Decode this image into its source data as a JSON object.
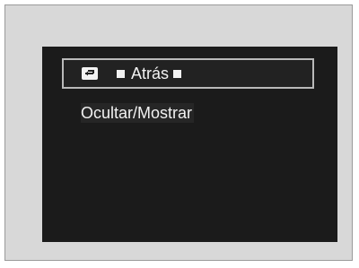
{
  "menu": {
    "back": {
      "icon": "return-arrow-icon",
      "label": "Atrás"
    },
    "items": [
      {
        "label": "Ocultar/Mostrar"
      }
    ]
  },
  "colors": {
    "screen_background": "#1b1b1b",
    "text": "#f2f2f2",
    "selection_border": "#b9b9b9",
    "outer_background": "#d8d8d8"
  }
}
